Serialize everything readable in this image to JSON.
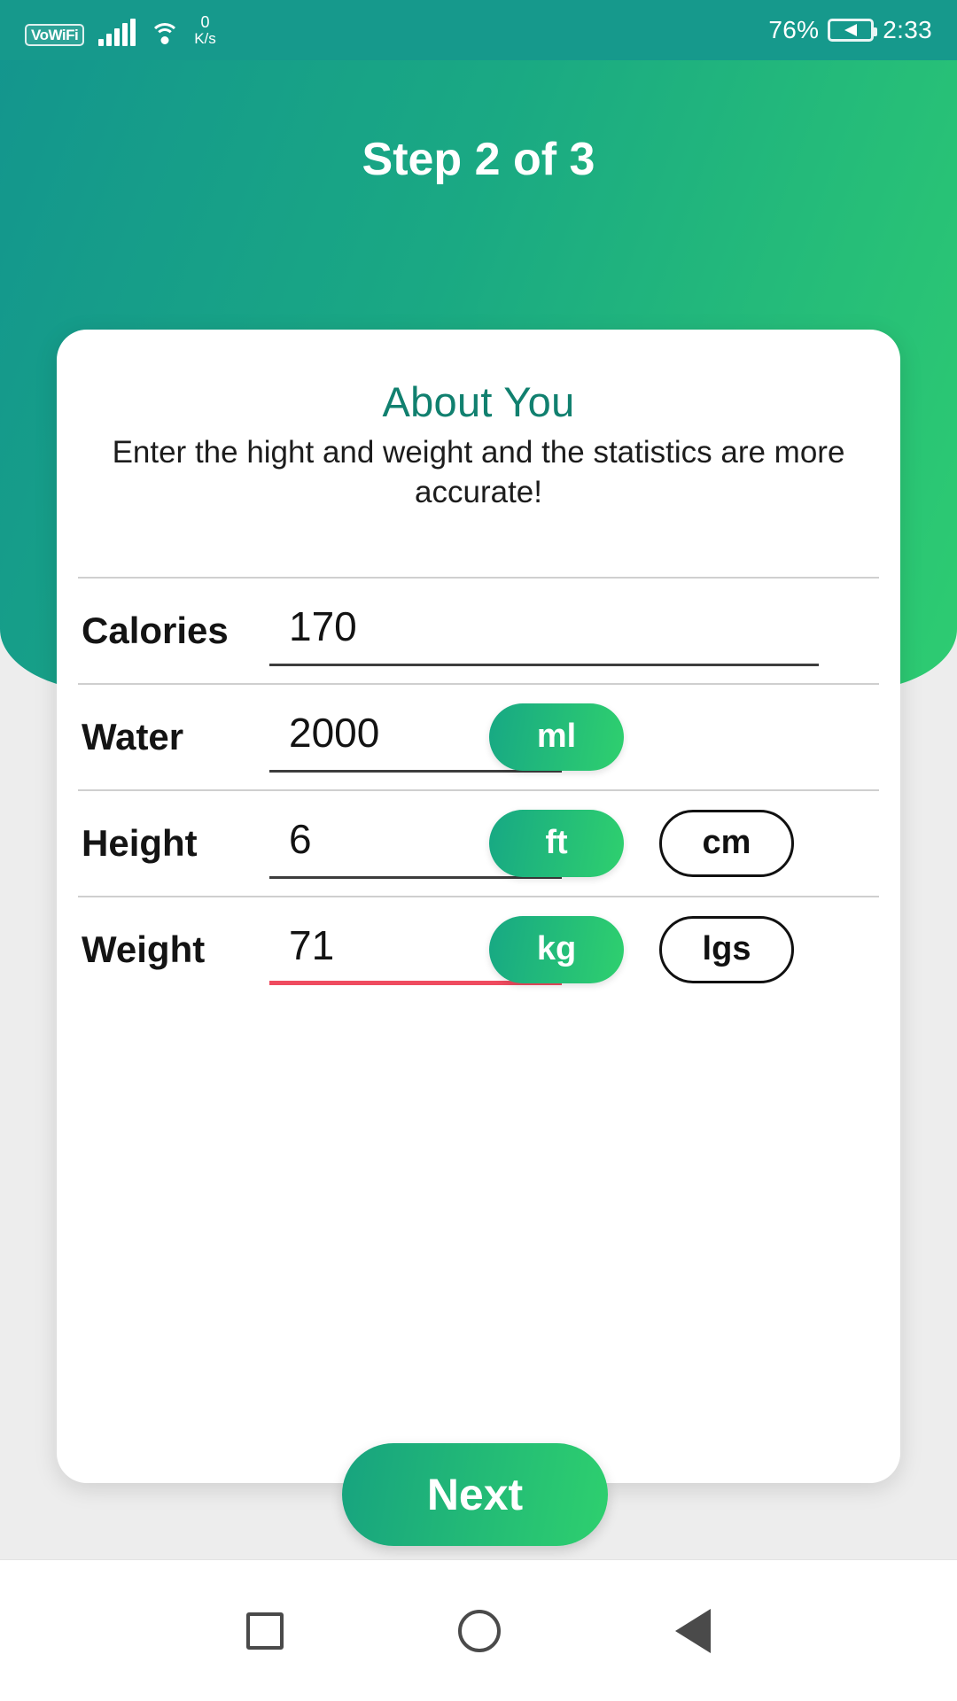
{
  "status_bar": {
    "vowifi_label": "VoWiFi",
    "wifi_icon": "wifi-icon",
    "signal_icon": "signal-bars-icon",
    "data_rate_value": "0",
    "data_rate_unit": "K/s",
    "battery_percent": "76%",
    "battery_icon": "battery-charging-icon",
    "time": "2:33"
  },
  "header": {
    "step_title": "Step 2 of 3",
    "gradient_from": "#13958e",
    "gradient_to": "#2ecc71"
  },
  "card": {
    "title": "About You",
    "title_color": "#11806f",
    "subtitle": "Enter the hight and weight and the statistics are more accurate!"
  },
  "fields": [
    {
      "label": "Calories",
      "value": "170",
      "underline_state": "normal",
      "underline_color": "#3d3d3d",
      "units": []
    },
    {
      "label": "Water",
      "value": "2000",
      "underline_state": "normal",
      "underline_color": "#3d3d3d",
      "units": [
        {
          "label": "ml",
          "selected": true
        }
      ]
    },
    {
      "label": "Height",
      "value": "6",
      "underline_state": "normal",
      "underline_color": "#3d3d3d",
      "units": [
        {
          "label": "ft",
          "selected": true
        },
        {
          "label": "cm",
          "selected": false
        }
      ]
    },
    {
      "label": "Weight",
      "value": "71",
      "underline_state": "error",
      "underline_color": "#ef4b5f",
      "units": [
        {
          "label": "kg",
          "selected": true
        },
        {
          "label": "lgs",
          "selected": false
        }
      ]
    }
  ],
  "next_button": {
    "label": "Next",
    "accent_from": "#17a37f",
    "accent_to": "#2ed06e"
  },
  "nav_bar": {
    "recents_icon": "square-recents-icon",
    "home_icon": "circle-home-icon",
    "back_icon": "triangle-back-icon"
  }
}
